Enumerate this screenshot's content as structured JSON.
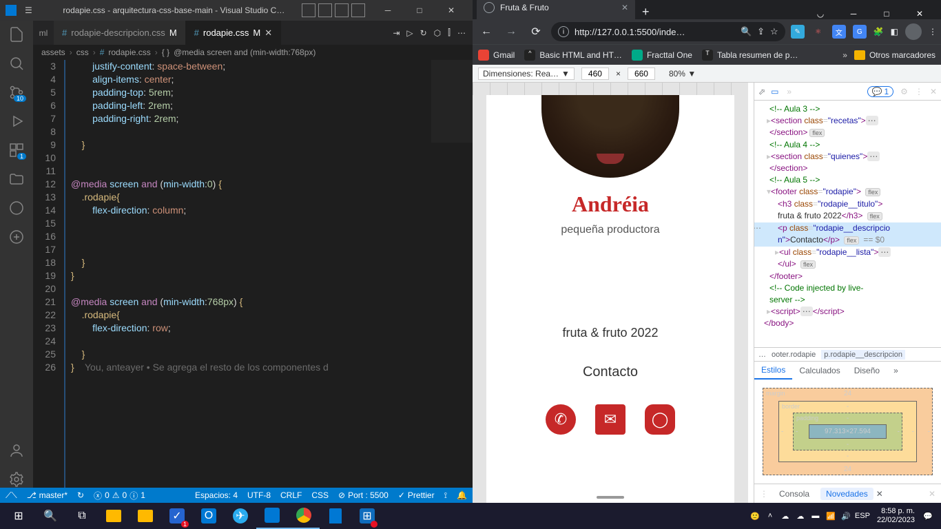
{
  "vscode": {
    "title": "rodapie.css - arquitectura-css-base-main - Visual Studio C…",
    "tabs": [
      {
        "file": "rodapie-descripcion.css",
        "modified": "M",
        "active": false
      },
      {
        "file": "rodapie.css",
        "modified": "M",
        "active": true
      }
    ],
    "ml_tab": "ml",
    "breadcrumb": {
      "seg1": "assets",
      "seg2": "css",
      "seg3": "rodapie.css",
      "seg4": "@media screen and (min-width:768px)"
    },
    "source_control_badge": "10",
    "testing_badge": "1",
    "code_lines": [
      {
        "n": "3",
        "html": "        <span class='c-prop'>justify-content</span><span class='c-punc'>: </span><span class='c-val'>space-between</span><span class='c-punc'>;</span>"
      },
      {
        "n": "4",
        "html": "        <span class='c-prop'>align-items</span><span class='c-punc'>: </span><span class='c-val'>center</span><span class='c-punc'>;</span>"
      },
      {
        "n": "5",
        "html": "        <span class='c-prop'>padding-top</span><span class='c-punc'>: </span><span class='c-num'>5rem</span><span class='c-punc'>;</span>"
      },
      {
        "n": "6",
        "html": "        <span class='c-prop'>padding-left</span><span class='c-punc'>: </span><span class='c-num'>2rem</span><span class='c-punc'>;</span>"
      },
      {
        "n": "7",
        "html": "        <span class='c-prop'>padding-right</span><span class='c-punc'>: </span><span class='c-num'>2rem</span><span class='c-punc'>;</span>"
      },
      {
        "n": "8",
        "html": ""
      },
      {
        "n": "9",
        "html": "    <span class='c-sel'>}</span>"
      },
      {
        "n": "10",
        "html": ""
      },
      {
        "n": "11",
        "html": ""
      },
      {
        "n": "12",
        "html": "<span class='c-kw'>@media</span> <span class='c-prop'>screen</span> <span class='c-kw'>and</span> <span class='c-punc'>(</span><span class='c-prop'>min-width</span><span class='c-punc'>:</span><span class='c-num'>0</span><span class='c-punc'>)</span> <span class='c-sel'>{</span>"
      },
      {
        "n": "13",
        "html": "    <span class='c-sel'>.rodapie{</span>"
      },
      {
        "n": "14",
        "html": "        <span class='c-prop'>flex-direction</span><span class='c-punc'>: </span><span class='c-val'>column</span><span class='c-punc'>;</span>"
      },
      {
        "n": "15",
        "html": ""
      },
      {
        "n": "16",
        "html": ""
      },
      {
        "n": "17",
        "html": ""
      },
      {
        "n": "18",
        "html": "    <span class='c-sel'>}</span>"
      },
      {
        "n": "19",
        "html": "<span class='c-sel'>}</span>"
      },
      {
        "n": "20",
        "html": ""
      },
      {
        "n": "21",
        "html": "<span class='c-kw'>@media</span> <span class='c-prop'>screen</span> <span class='c-kw'>and</span> <span class='c-punc'>(</span><span class='c-prop'>min-width</span><span class='c-punc'>:</span><span class='c-num'>768px</span><span class='c-punc'>)</span> <span class='c-sel'>{</span>"
      },
      {
        "n": "22",
        "html": "    <span class='c-sel'>.rodapie{</span>"
      },
      {
        "n": "23",
        "html": "        <span class='c-prop'>flex-direction</span><span class='c-punc'>: </span><span class='c-val'>row</span><span class='c-punc'>;</span>"
      },
      {
        "n": "24",
        "html": ""
      },
      {
        "n": "25",
        "html": "    <span class='c-sel'>}</span>"
      },
      {
        "n": "26",
        "html": "<span class='c-sel'>}</span>    <span class='c-blame'>You, anteayer • Se agrega el resto de los componentes d</span>"
      }
    ],
    "status": {
      "branch": "master*",
      "errors": "0",
      "warnings": "0",
      "info": "1",
      "spaces": "Espacios: 4",
      "encoding": "UTF-8",
      "eol": "CRLF",
      "lang": "CSS",
      "port": "Port : 5500",
      "prettier": "Prettier"
    }
  },
  "chrome": {
    "tab_title": "Fruta & Fruto",
    "url": "http://127.0.0.1:5500/inde…",
    "bookmarks": [
      {
        "label": "Gmail",
        "color": "#ea4335"
      },
      {
        "label": "Basic HTML and HT…",
        "color": "#333"
      },
      {
        "label": "Fracttal One",
        "color": "#2a7"
      },
      {
        "label": "Tabla resumen de p…",
        "color": "#333"
      }
    ],
    "other_bookmarks": "Otros marcadores",
    "devtoolbar": {
      "dim_label": "Dimensiones: Rea…",
      "w": "460",
      "x": "×",
      "h": "660",
      "zoom": "80%"
    },
    "preview": {
      "name": "Andréia",
      "role": "pequeña productora",
      "footer_title": "fruta & fruto 2022",
      "contacto": "Contacto"
    },
    "elements": {
      "aula3": "<!-- Aula 3 -->",
      "recetas_open": "<section class=\"recetas\">",
      "recetas_close": "</section>",
      "aula4": "<!-- Aula 4 -->",
      "quienes_open": "<section class=\"quienes\">",
      "quienes_close": "</section>",
      "aula5": "<!-- Aula 5 -->",
      "footer_open": "<footer class=\"rodapie\">",
      "h3": "<h3 class=\"rodapie__titulo\">",
      "h3_txt": "fruta & fruto 2022",
      "h3_close": "</h3>",
      "p_open": "<p class=\"rodapie__descripcion\">",
      "p_txt": "Contacto",
      "p_close": "</p>",
      "dollar": "== $0",
      "ul": "<ul class=\"rodapie__lista\">",
      "ul_close": "</ul>",
      "footer_close": "</footer>",
      "inject": "<!-- Code injected by live-server -->",
      "script": "<script>",
      "script_close": "</script>",
      "body_close": "</body>"
    },
    "bc_path": {
      "a": "…",
      "b": "ooter.rodapie",
      "c": "p.rodapie__descripcion"
    },
    "styles_tabs": [
      "Estilos",
      "Calculados",
      "Diseño"
    ],
    "box": {
      "margin_t": "24",
      "margin_b": "24",
      "content": "97.313×27.594",
      "dash": "-"
    },
    "messages": "1",
    "drawer": {
      "consola": "Consola",
      "novedades": "Novedades"
    }
  },
  "taskbar": {
    "time": "8:58 p. m.",
    "date": "22/02/2023",
    "lang": "ESP"
  }
}
